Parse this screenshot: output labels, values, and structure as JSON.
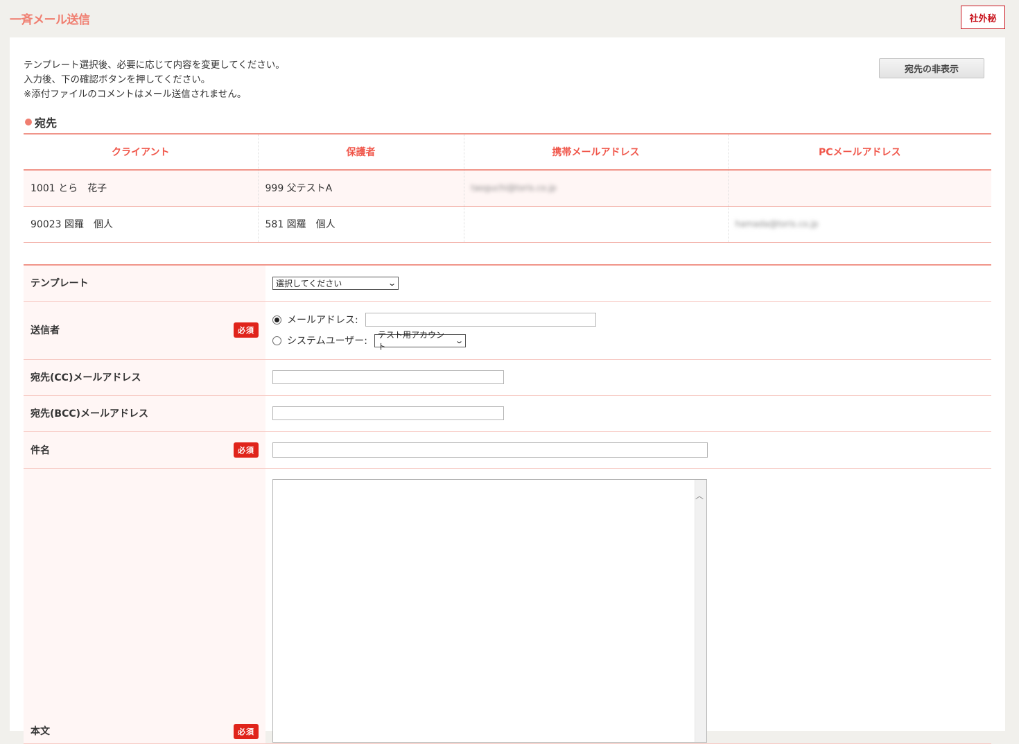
{
  "header": {
    "title": "一斉メール送信",
    "confidential_label": "社外秘"
  },
  "instructions": [
    "テンプレート選択後、必要に応じて内容を変更してください。",
    "入力後、下の確認ボタンを押してください。",
    "※添付ファイルのコメントはメール送信されません。"
  ],
  "hide_button_label": "宛先の非表示",
  "recipients": {
    "section_title": "宛先",
    "columns": [
      "クライアント",
      "保護者",
      "携帯メールアドレス",
      "PCメールアドレス"
    ],
    "rows": [
      {
        "client": "1001 とら　花子",
        "guardian": "999 父テストA",
        "mobile": "taoguchi@toris.co.jp",
        "pc": ""
      },
      {
        "client": "90023 図羅　個人",
        "guardian": "581 図羅　個人",
        "mobile": "",
        "pc": "hamada@toris.co.jp"
      }
    ]
  },
  "form": {
    "required_label": "必須",
    "template": {
      "label": "テンプレート",
      "value": "選択してください"
    },
    "sender": {
      "label": "送信者",
      "option_email": "メールアドレス:",
      "option_system": "システムユーザー:",
      "system_user_value": "テスト用アカウント",
      "selected": "email"
    },
    "cc": {
      "label": "宛先(CC)メールアドレス"
    },
    "bcc": {
      "label": "宛先(BCC)メールアドレス"
    },
    "subject": {
      "label": "件名"
    },
    "body": {
      "label": "本文"
    }
  },
  "colors": {
    "accent": "#f07e70",
    "header_text": "#f0564a",
    "required_badge": "#e0241b",
    "label_bg": "#fff6f5"
  }
}
